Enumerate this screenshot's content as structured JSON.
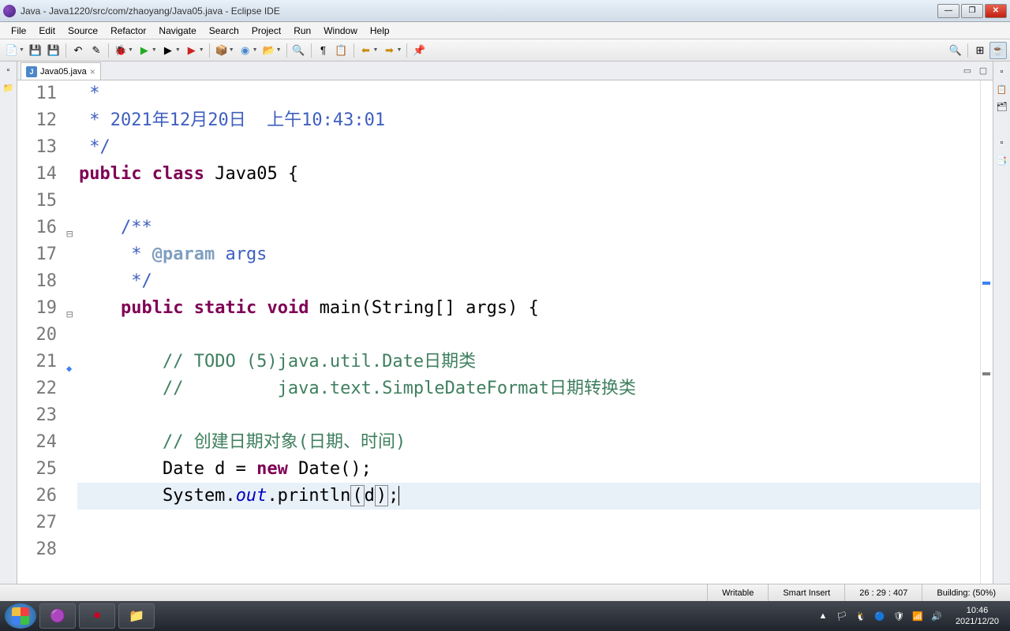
{
  "window": {
    "title": "Java - Java1220/src/com/zhaoyang/Java05.java - Eclipse IDE"
  },
  "menu": {
    "items": [
      "File",
      "Edit",
      "Source",
      "Refactor",
      "Navigate",
      "Search",
      "Project",
      "Run",
      "Window",
      "Help"
    ]
  },
  "tab": {
    "name": "Java05.java",
    "closeGlyph": "×"
  },
  "code": {
    "lines": [
      {
        "n": "11",
        "html": "<span class='javadoc'> *</span>"
      },
      {
        "n": "12",
        "html": "<span class='javadoc'> * 2021年12月20日  上午10:43:01</span>"
      },
      {
        "n": "13",
        "html": "<span class='javadoc'> */</span>"
      },
      {
        "n": "14",
        "html": "<span class='kw'>public</span> <span class='kw'>class</span> Java05 {"
      },
      {
        "n": "15",
        "html": ""
      },
      {
        "n": "16",
        "html": "    <span class='javadoc'>/**</span>",
        "mark": "collapse"
      },
      {
        "n": "17",
        "html": "<span class='javadoc'>     * <span class='tag'>@param</span> args</span>"
      },
      {
        "n": "18",
        "html": "<span class='javadoc'>     */</span>"
      },
      {
        "n": "19",
        "html": "    <span class='kw'>public</span> <span class='kw'>static</span> <span class='kw'>void</span> main(String[] args) {",
        "mark": "collapse"
      },
      {
        "n": "20",
        "html": ""
      },
      {
        "n": "21",
        "html": "        <span class='comment'>// TODO (5)java.util.Date日期类</span>",
        "mark": "todo"
      },
      {
        "n": "22",
        "html": "        <span class='comment'>//         java.text.SimpleDateFormat日期转换类</span>"
      },
      {
        "n": "23",
        "html": ""
      },
      {
        "n": "24",
        "html": "        <span class='comment'>// 创建日期对象(日期、时间)</span>"
      },
      {
        "n": "25",
        "html": "        Date d = <span class='kw'>new</span> Date();"
      },
      {
        "n": "26",
        "html": "        System.<span class='field'>out</span>.println<span class='boxed'>(</span>d<span class='boxed'>)</span>;<span class='caret'></span>",
        "current": true
      },
      {
        "n": "27",
        "html": ""
      },
      {
        "n": "28",
        "html": ""
      }
    ]
  },
  "status": {
    "writable": "Writable",
    "insertMode": "Smart Insert",
    "position": "26 : 29 : 407",
    "building": "Building: (50%)"
  },
  "taskbar": {
    "time": "10:46",
    "date": "2021/12/20"
  }
}
